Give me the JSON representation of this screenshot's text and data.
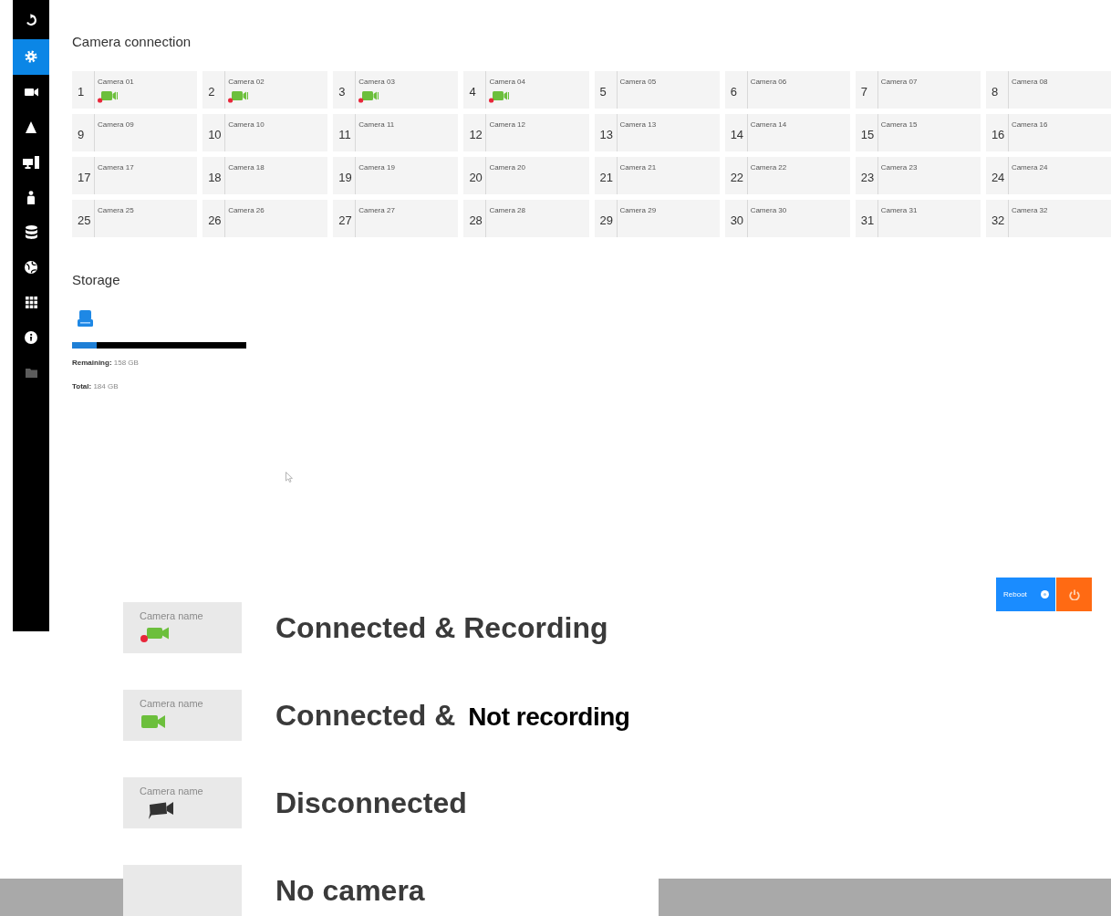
{
  "sidebar": {
    "items": [
      {
        "selected": false,
        "disabled": false
      },
      {
        "selected": true,
        "disabled": false
      },
      {
        "selected": false,
        "disabled": false
      },
      {
        "selected": false,
        "disabled": false
      },
      {
        "selected": false,
        "disabled": false
      },
      {
        "selected": false,
        "disabled": false
      },
      {
        "selected": false,
        "disabled": false
      },
      {
        "selected": false,
        "disabled": false
      },
      {
        "selected": false,
        "disabled": false
      },
      {
        "selected": false,
        "disabled": false
      },
      {
        "selected": false,
        "disabled": true
      }
    ]
  },
  "camera_connection": {
    "title": "Camera connection",
    "cells": [
      {
        "number": "1",
        "name": "Camera 01",
        "kind": "recording"
      },
      {
        "number": "2",
        "name": "Camera 02",
        "kind": "recording"
      },
      {
        "number": "3",
        "name": "Camera 03",
        "kind": "recording"
      },
      {
        "number": "4",
        "name": "Camera 04",
        "kind": "recording"
      },
      {
        "number": "5",
        "name": "Camera 05",
        "kind": "named"
      },
      {
        "number": "6",
        "name": "Camera 06",
        "kind": "named"
      },
      {
        "number": "7",
        "name": "Camera 07",
        "kind": "named"
      },
      {
        "number": "8",
        "name": "Camera 08",
        "kind": "named"
      },
      {
        "number": "9",
        "name": "Camera 09",
        "kind": "named"
      },
      {
        "number": "10",
        "name": "Camera 10",
        "kind": "named"
      },
      {
        "number": "11",
        "name": "Camera 11",
        "kind": "named"
      },
      {
        "number": "12",
        "name": "Camera 12",
        "kind": "named"
      },
      {
        "number": "13",
        "name": "Camera 13",
        "kind": "named"
      },
      {
        "number": "14",
        "name": "Camera 14",
        "kind": "named"
      },
      {
        "number": "15",
        "name": "Camera 15",
        "kind": "named"
      },
      {
        "number": "16",
        "name": "Camera 16",
        "kind": "named"
      },
      {
        "number": "17",
        "name": "Camera 17",
        "kind": "named"
      },
      {
        "number": "18",
        "name": "Camera 18",
        "kind": "named"
      },
      {
        "number": "19",
        "name": "Camera 19",
        "kind": "named"
      },
      {
        "number": "20",
        "name": "Camera 20",
        "kind": "named"
      },
      {
        "number": "21",
        "name": "Camera 21",
        "kind": "named"
      },
      {
        "number": "22",
        "name": "Camera 22",
        "kind": "named"
      },
      {
        "number": "23",
        "name": "Camera 23",
        "kind": "named"
      },
      {
        "number": "24",
        "name": "Camera 24",
        "kind": "named"
      },
      {
        "number": "25",
        "name": "Camera 25",
        "kind": "named"
      },
      {
        "number": "26",
        "name": "Camera 26",
        "kind": "named"
      },
      {
        "number": "27",
        "name": "Camera 27",
        "kind": "named"
      },
      {
        "number": "28",
        "name": "Camera 28",
        "kind": "named"
      },
      {
        "number": "29",
        "name": "Camera 29",
        "kind": "named"
      },
      {
        "number": "30",
        "name": "Camera 30",
        "kind": "named"
      },
      {
        "number": "31",
        "name": "Camera 31",
        "kind": "named"
      },
      {
        "number": "32",
        "name": "Camera 32",
        "kind": "named"
      }
    ]
  },
  "storage": {
    "title": "Storage",
    "level": 0.14,
    "remaining": "**Remaining:** 158 GB",
    "total": "**Total:** 184 GB"
  },
  "actions": {
    "reboot": "Reboot"
  },
  "legend": [
    {
      "kind": "recording",
      "sample_name": "Camera name",
      "label": "Connected & Recording"
    },
    {
      "kind": "connected",
      "sample_name": "Camera name",
      "label": "Connected &",
      "label_suffix": "Not recording"
    },
    {
      "kind": "disconnected",
      "sample_name": "Camera name",
      "label": "Disconnected"
    },
    {
      "kind": "empty",
      "label": "No camera"
    }
  ]
}
